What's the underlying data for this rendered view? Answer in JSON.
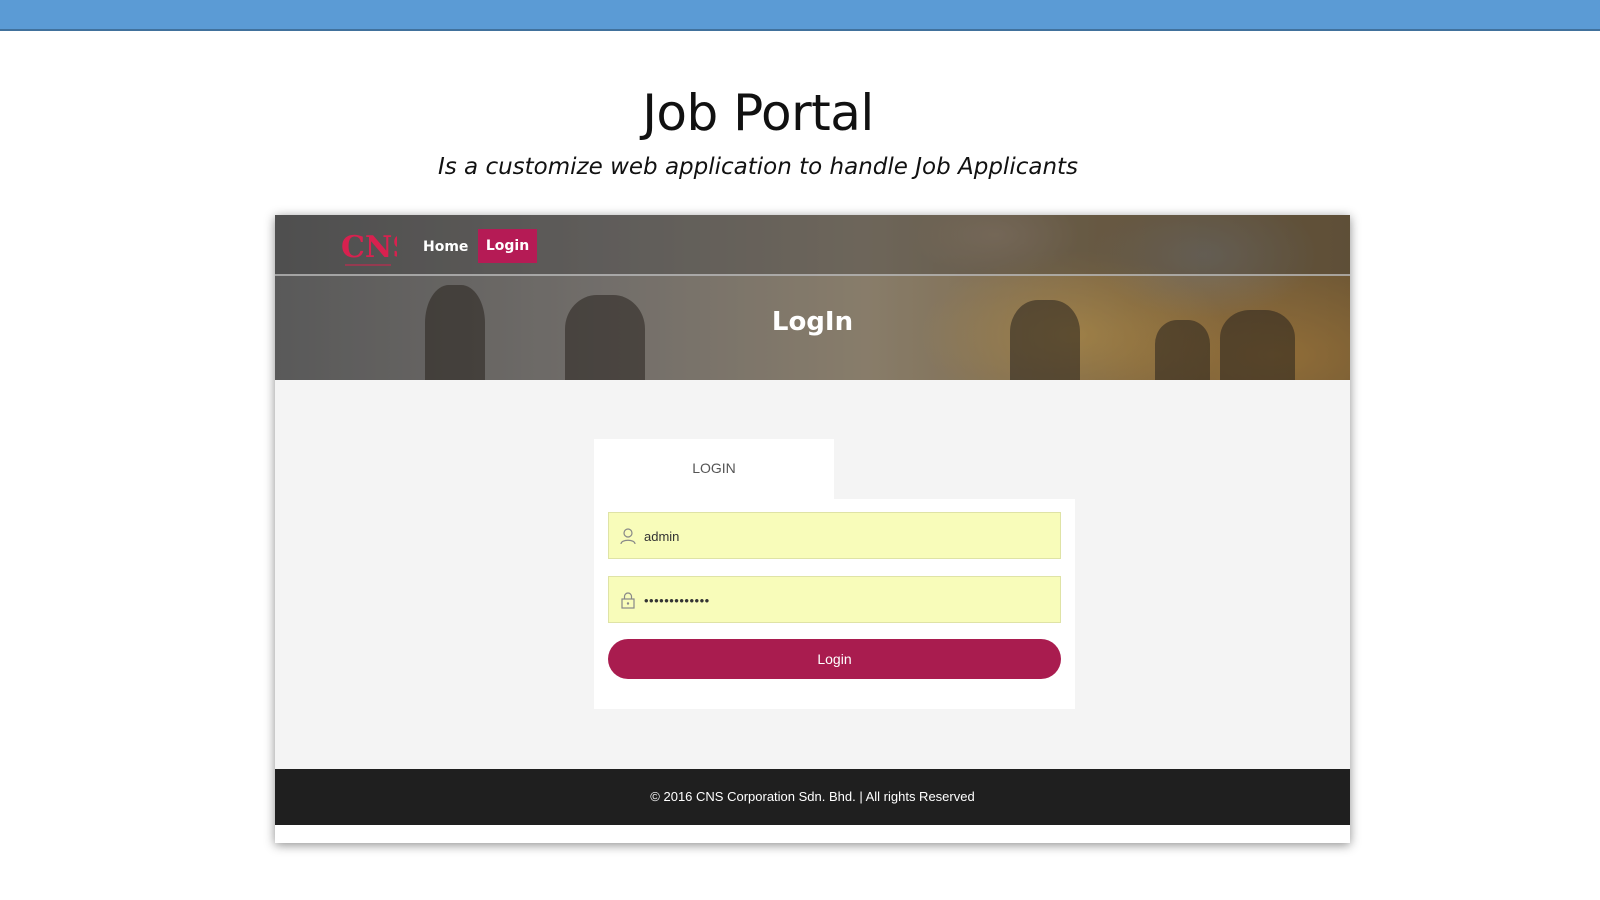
{
  "slide": {
    "title": "Job Portal",
    "subtitle": "Is a customize web application to handle Job Applicants"
  },
  "navbar": {
    "logo_text": "CNS",
    "home_label": "Home",
    "login_label": "Login"
  },
  "hero": {
    "title": "LogIn"
  },
  "login_form": {
    "tab_label": "LOGIN",
    "username_value": "admin",
    "password_value": "•••••••••••••",
    "submit_label": "Login"
  },
  "footer": {
    "text": "© 2016 CNS Corporation Sdn. Bhd. | All rights Reserved"
  },
  "colors": {
    "top_bar": "#5b9bd5",
    "accent": "#b51b55",
    "button": "#a91c4f",
    "field_bg": "#f8fcba",
    "footer_bg": "#1f1f1f"
  },
  "icons": {
    "logo": "cns-logo",
    "user_field": "user-icon",
    "password_field": "lock-icon"
  }
}
